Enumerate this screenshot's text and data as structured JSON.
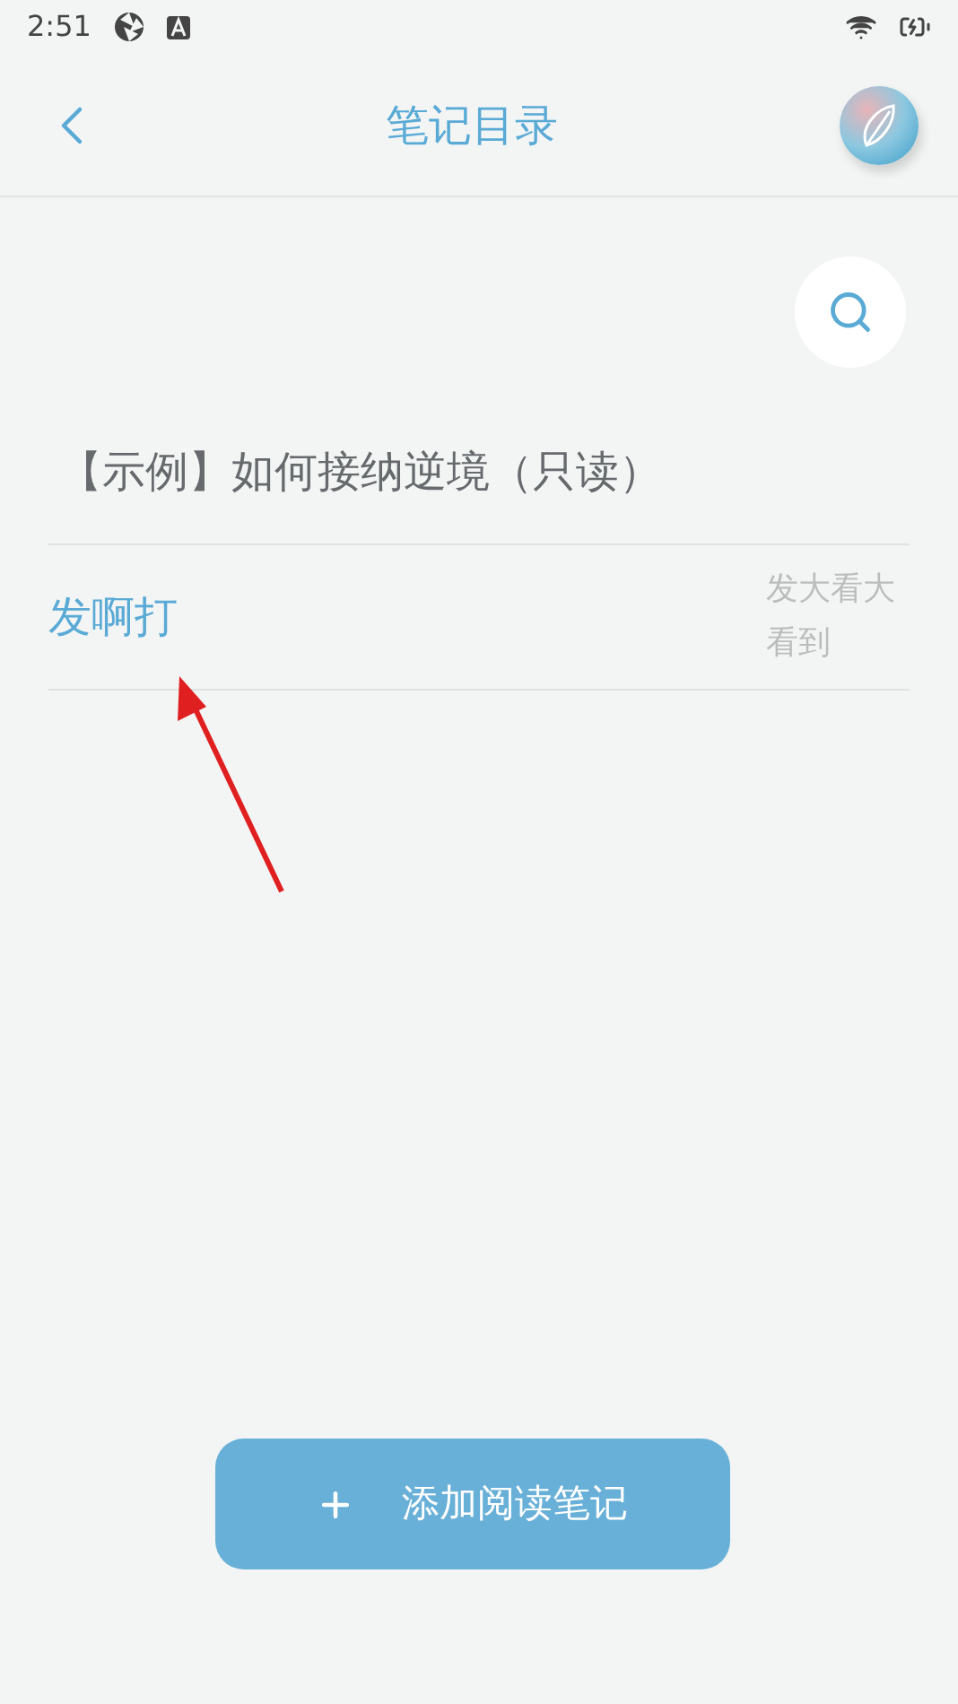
{
  "status_bar": {
    "time": "2:51"
  },
  "header": {
    "title": "笔记目录"
  },
  "book": {
    "title": "【示例】如何接纳逆境（只读）"
  },
  "notes": [
    {
      "title": "发啊打",
      "excerpt": "发大看大看到"
    }
  ],
  "add_button": {
    "label": "添加阅读笔记"
  }
}
